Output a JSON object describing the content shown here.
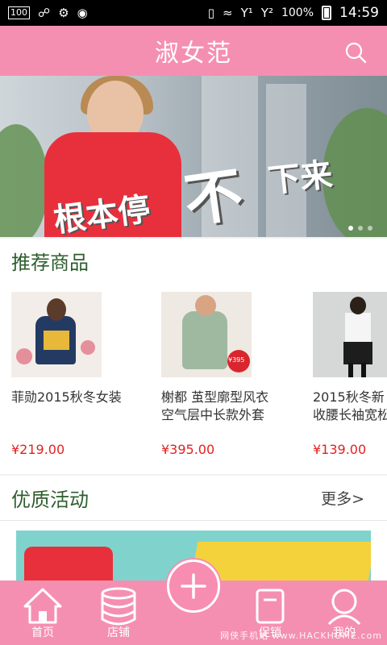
{
  "status_bar": {
    "left_box": "100",
    "battery_percent": "100%",
    "time": "14:59",
    "icons": [
      "usb-icon",
      "android-icon",
      "android-robot-icon",
      "vibrate-icon",
      "wifi-icon",
      "signal-1-icon",
      "signal-2-icon",
      "battery-icon"
    ]
  },
  "app_bar": {
    "title": "淑女范",
    "search_icon": "search-icon"
  },
  "banner": {
    "text_left": "根本停",
    "text_mid": "不",
    "text_right": "下来",
    "page_count": 3,
    "active_index": 0
  },
  "recommended": {
    "title": "推荐商品",
    "products": [
      {
        "name": "菲勋2015秋冬女装",
        "price": "¥219.00"
      },
      {
        "name": "榭都 茧型廓型风衣\n空气层中长款外套",
        "price": "¥395.00",
        "badge": "¥395"
      },
      {
        "name": "2015秋冬新\n收腰长袖宽松",
        "price": "¥139.00"
      }
    ]
  },
  "activity": {
    "title": "优质活动",
    "more_label": "更多>"
  },
  "bottom_nav": {
    "items": [
      {
        "label": "首页",
        "icon": "home-icon"
      },
      {
        "label": "店铺",
        "icon": "database-icon"
      },
      {
        "label": "促销",
        "icon": "tag-icon"
      },
      {
        "label": "我的",
        "icon": "user-icon"
      }
    ],
    "fab_icon": "plus-icon",
    "watermark": "www.HACKHOME.com",
    "watermark_cn": "网侠手机站"
  },
  "colors": {
    "brand_pink": "#f58fb1",
    "section_title": "#2e5e2e",
    "price": "#e52020"
  }
}
